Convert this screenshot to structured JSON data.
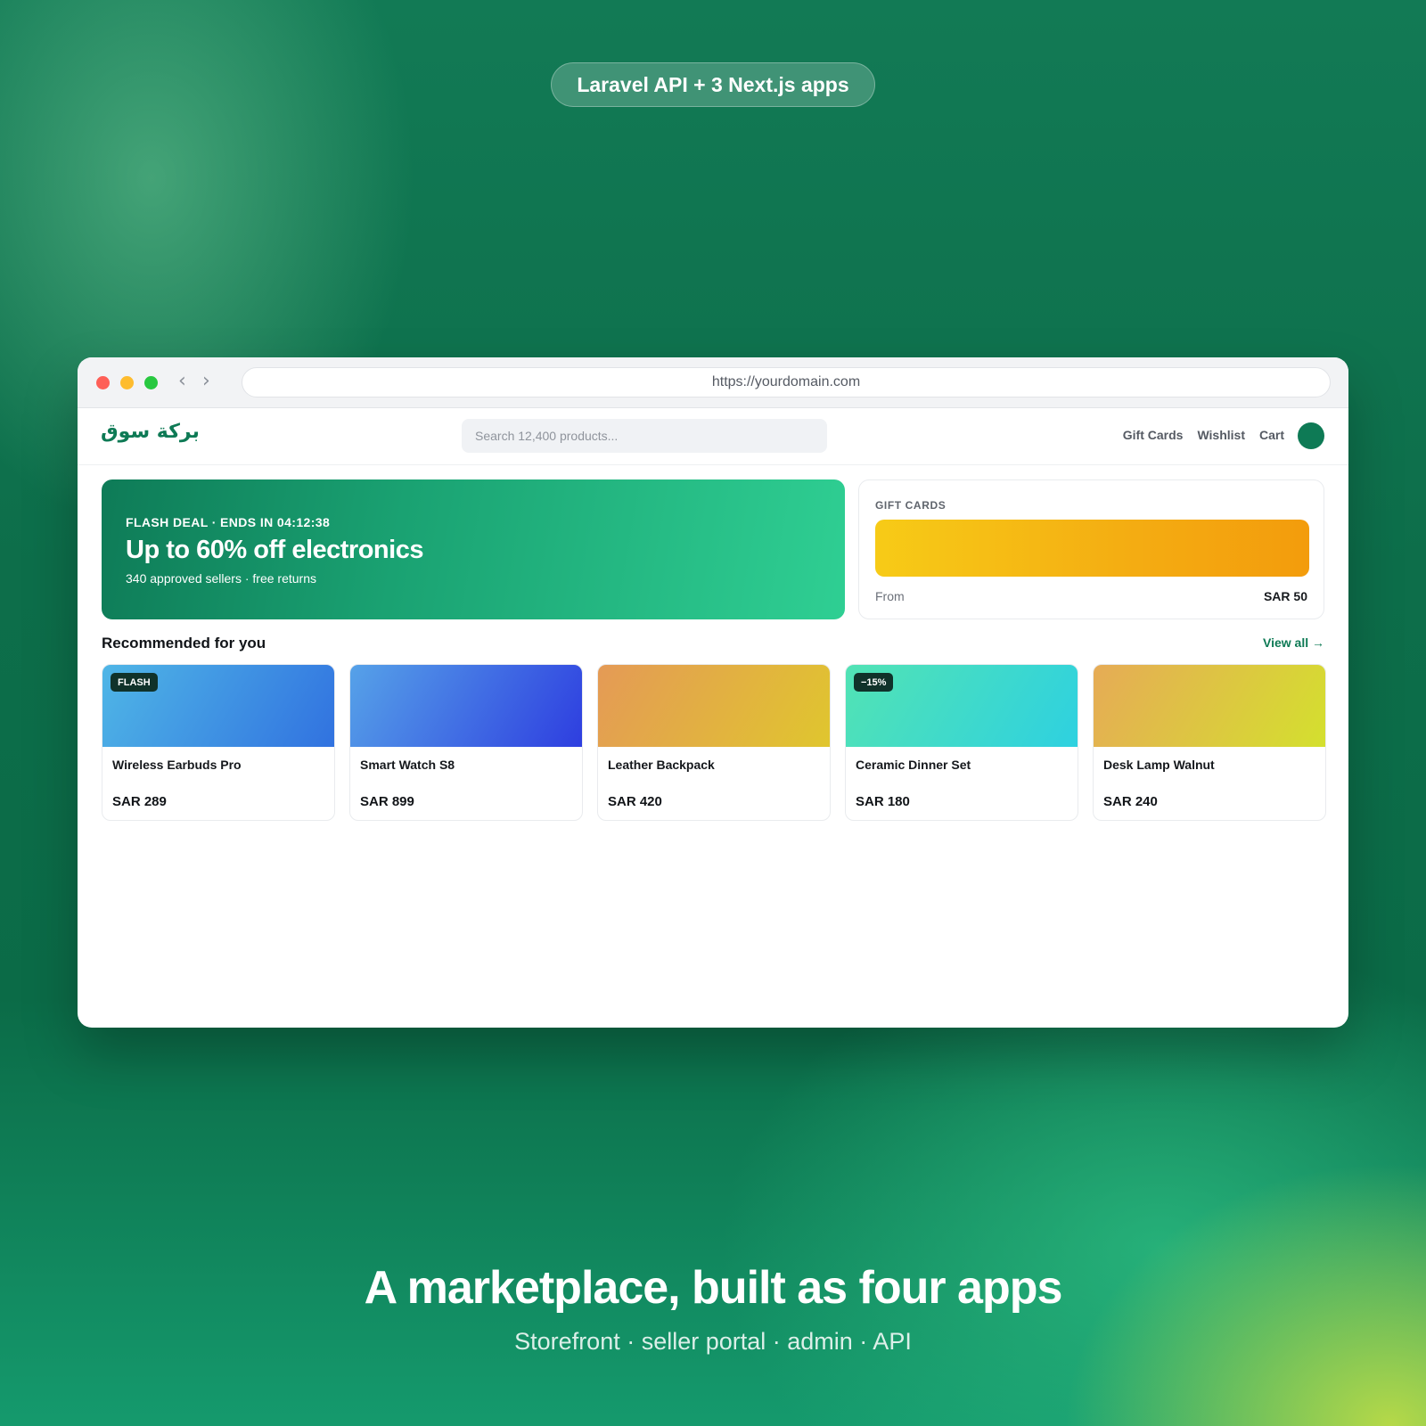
{
  "banner": {
    "pill_text": "Laravel API + 3 Next.js apps"
  },
  "browser": {
    "url": "https://yourdomain.com"
  },
  "site": {
    "logo": "بركة سوق",
    "search_placeholder": "Search 12,400 products...",
    "nav": [
      "Gift Cards",
      "Wishlist",
      "Cart"
    ],
    "accent_color": "#0e7a55"
  },
  "hero": {
    "eyebrow": "FLASH DEAL · ENDS IN 04:12:38",
    "title": "Up to 60% off electronics",
    "subtitle": "340 approved sellers · free returns"
  },
  "gift_cards": {
    "heading": "GIFT CARDS",
    "from_label": "From",
    "price": "SAR 50"
  },
  "recommended": {
    "title": "Recommended for you",
    "view_all": "View all →",
    "products": [
      {
        "name": "Wireless Earbuds Pro",
        "price": "SAR 289",
        "badge": "FLASH",
        "gradient": [
          "#4fb6e6",
          "#3172e0"
        ]
      },
      {
        "name": "Smart Watch S8",
        "price": "SAR 899",
        "badge": "",
        "gradient": [
          "#56a2e8",
          "#2e3ee0"
        ]
      },
      {
        "name": "Leather Backpack",
        "price": "SAR 420",
        "badge": "",
        "gradient": [
          "#e49a56",
          "#e0c62e"
        ]
      },
      {
        "name": "Ceramic Dinner Set",
        "price": "SAR 180",
        "badge": "−15%",
        "gradient": [
          "#52e3b4",
          "#2ed1e0"
        ]
      },
      {
        "name": "Desk Lamp Walnut",
        "price": "SAR 240",
        "badge": "",
        "gradient": [
          "#e6ab56",
          "#d4e02e"
        ]
      }
    ]
  },
  "footer": {
    "title": "A marketplace, built as four apps",
    "subtitle": "Storefront · seller portal · admin · API"
  }
}
